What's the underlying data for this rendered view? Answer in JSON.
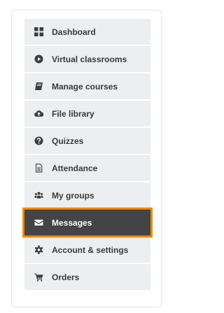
{
  "menu": {
    "items": [
      {
        "label": "Dashboard",
        "icon": "dashboard-grid-icon",
        "active": false
      },
      {
        "label": "Virtual classrooms",
        "icon": "play-circle-icon",
        "active": false
      },
      {
        "label": "Manage courses",
        "icon": "book-icon",
        "active": false
      },
      {
        "label": "File library",
        "icon": "cloud-upload-icon",
        "active": false
      },
      {
        "label": "Quizzes",
        "icon": "question-circle-icon",
        "active": false
      },
      {
        "label": "Attendance",
        "icon": "document-icon",
        "active": false
      },
      {
        "label": "My groups",
        "icon": "users-icon",
        "active": false
      },
      {
        "label": "Messages",
        "icon": "envelope-icon",
        "active": true
      },
      {
        "label": "Account & settings",
        "icon": "gear-icon",
        "active": false
      },
      {
        "label": "Orders",
        "icon": "shopping-cart-icon",
        "active": false
      }
    ]
  },
  "colors": {
    "item_background": "#eceeef",
    "active_background": "#444444",
    "active_outline": "#f08a00",
    "text": "#3a3a3a",
    "active_text": "#ffffff"
  }
}
